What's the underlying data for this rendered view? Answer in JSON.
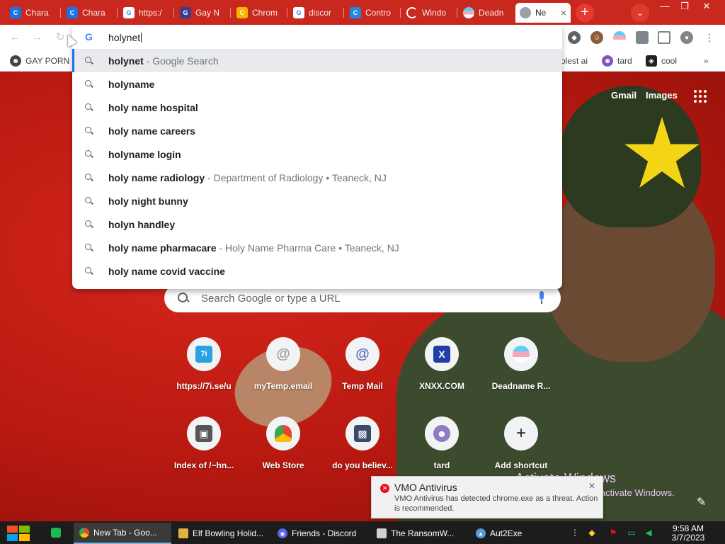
{
  "tabs": [
    {
      "title": "Chara",
      "color": "#1a73e8",
      "glyph": "C"
    },
    {
      "title": "Chara",
      "color": "#1a73e8",
      "glyph": "C"
    },
    {
      "title": "https:/",
      "color": "#4285f4",
      "glyph": "G"
    },
    {
      "title": "Gay N",
      "color": "#3b3b8f",
      "glyph": "G"
    },
    {
      "title": "Chrom",
      "color": "#f4b400",
      "glyph": "C"
    },
    {
      "title": "discor",
      "color": "#4285f4",
      "glyph": "G"
    },
    {
      "title": "Contro",
      "color": "#1e88e5",
      "glyph": "C"
    },
    {
      "title": "Windo",
      "color": "#9e9e9e",
      "glyph": "W"
    },
    {
      "title": "Deadn",
      "color": "#f5a9b8",
      "glyph": "D"
    },
    {
      "title": "Ne",
      "color": "#9aa0a6",
      "glyph": "N",
      "active": true
    }
  ],
  "window": {
    "newtab": "+",
    "tabsearch": "⌄",
    "minimize": "—",
    "maximize": "❐",
    "close": "✕"
  },
  "omnibox": {
    "input_text": "holynet",
    "suggestions": [
      {
        "bold": "holynet",
        "desc": " - Google Search",
        "selected": true
      },
      {
        "bold": "holyname",
        "desc": ""
      },
      {
        "bold": "holy name hospital",
        "desc": ""
      },
      {
        "bold": "holy name careers",
        "desc": ""
      },
      {
        "bold": "holyname login",
        "desc": ""
      },
      {
        "bold": "holy name radiology",
        "desc": " - Department of Radiology  •  Teaneck, NJ"
      },
      {
        "bold": "holy night bunny",
        "desc": ""
      },
      {
        "bold": "holyn handley",
        "desc": ""
      },
      {
        "bold": "holy name pharmacare",
        "desc": " - Holy Name Pharma Care  •  Teaneck, NJ"
      },
      {
        "bold": "holy name covid vaccine",
        "desc": ""
      }
    ]
  },
  "bookmarks": {
    "first": "GAY PORN",
    "items": [
      {
        "label": "olest ai",
        "color": "#4a4a4a"
      },
      {
        "label": "tard",
        "color": "#7e57c2"
      },
      {
        "label": "cool",
        "color": "#222222"
      }
    ],
    "more": "»"
  },
  "ntp": {
    "gmail": "Gmail",
    "images": "Images",
    "search_placeholder": "Search Google or type a URL",
    "shortcuts": [
      {
        "label": "https://7i.se/u",
        "glyph": "7i",
        "color": "#29a3e0"
      },
      {
        "label": "myTemp.email",
        "glyph": "@",
        "color": "#9e9e9e"
      },
      {
        "label": "Temp Mail",
        "glyph": "@",
        "color": "#5c6bc0"
      },
      {
        "label": "XNXX.COM",
        "glyph": "X",
        "color": "#1f3ea8"
      },
      {
        "label": "Deadname R...",
        "glyph": "≡",
        "color": "#5bcefa"
      },
      {
        "label": "Index of /~hn...",
        "glyph": "▣",
        "color": "#555555"
      },
      {
        "label": "Web Store",
        "glyph": "◒",
        "color": "#ea4335"
      },
      {
        "label": "do you believ...",
        "glyph": "▩",
        "color": "#3b4a6b"
      },
      {
        "label": "tard",
        "glyph": "☻",
        "color": "#8e7cc3"
      },
      {
        "label": "Add shortcut",
        "glyph": "+",
        "color": "#202124"
      }
    ],
    "activate_title": "Activate Windows",
    "activate_sub": "Go to PC settings to activate Windows."
  },
  "toast": {
    "title": "VMO Antivirus",
    "body": "VMO Antivirus has detected chrome.exe as a threat. Action is recommended.",
    "close": "✕"
  },
  "taskbar": {
    "apps": [
      {
        "label": "New Tab - Goo...",
        "color": "#4285f4",
        "active": true
      },
      {
        "label": "Elf Bowling Holid...",
        "color": "#e3b341"
      },
      {
        "label": "Friends - Discord",
        "color": "#5865f2"
      },
      {
        "label": "The RansomW...",
        "color": "#d0d0d0"
      },
      {
        "label": "Aut2Exe",
        "color": "#5a9bd5"
      }
    ],
    "time": "9:58 AM",
    "date": "3/7/2023"
  },
  "colors": {
    "accent": "#1a73e8",
    "tabstrip": "#c8281e",
    "page_bg": "#b71910",
    "star": "#f4d516"
  }
}
